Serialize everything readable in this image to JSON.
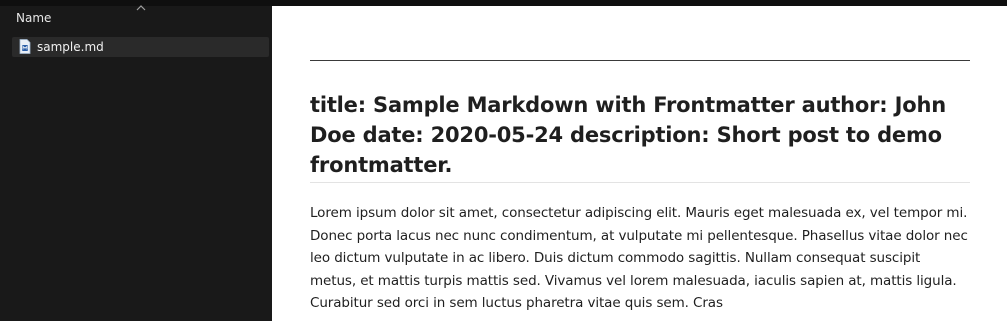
{
  "explorer": {
    "column_header": "Name",
    "files": [
      {
        "name": "sample.md",
        "icon": "markdown-file-icon"
      }
    ]
  },
  "preview": {
    "heading": "title: Sample Markdown with Frontmatter author: John Doe date: 2020-05-24 description: Short post to demo frontmatter.",
    "paragraph": "Lorem ipsum dolor sit amet, consectetur adipiscing elit. Mauris eget malesuada ex, vel tempor mi. Donec porta lacus nec nunc condimentum, at vulputate mi pellentesque. Phasellus vitae dolor nec leo dictum vulputate in ac libero. Duis dictum commodo sagittis. Nullam consequat suscipit metus, et mattis turpis mattis sed. Vivamus vel lorem malesuada, iaculis sapien at, mattis ligula. Curabitur sed orci in sem luctus pharetra vitae quis sem. Cras"
  },
  "colors": {
    "pane_background": "#191919",
    "selection": "#2a2a2a",
    "preview_background": "#ffffff",
    "text": "#1f1f1f"
  }
}
